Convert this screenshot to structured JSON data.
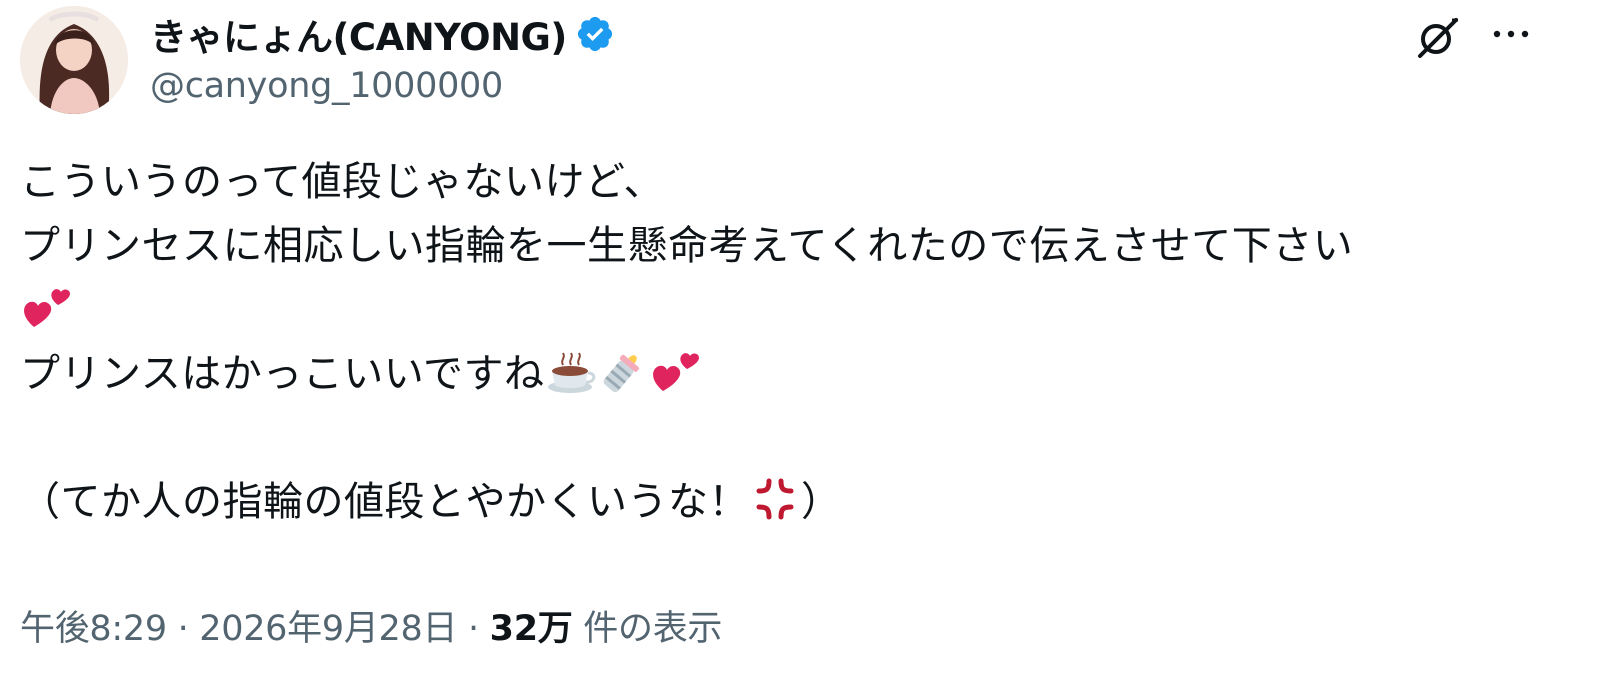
{
  "author": {
    "display_name": "きゃにょん(CANYONG)",
    "handle": "@canyong_1000000",
    "verified": true,
    "verified_color": "#1d9bf0"
  },
  "tweet": {
    "line1": "こういうのって値段じゃないけど、",
    "line2": "プリンセスに相応しい指輪を一生懸命考えてくれたので伝えさせて下さい",
    "line3": "プリンスはかっこいいですね",
    "line4": "（てか人の指輪の値段とやかくいうな！",
    "line4_end": "）",
    "emojis": [
      "two-hearts-icon",
      "hot-beverage-icon",
      "baby-bottle-icon",
      "two-hearts-icon",
      "anger-symbol-icon"
    ]
  },
  "meta": {
    "time": "午後8:29",
    "separator": " · ",
    "date": "2026年9月28日",
    "views_count": "32万",
    "views_label": " 件の表示"
  },
  "colors": {
    "text": "#0f1419",
    "secondary": "#536471",
    "heart": "#e0245e"
  }
}
